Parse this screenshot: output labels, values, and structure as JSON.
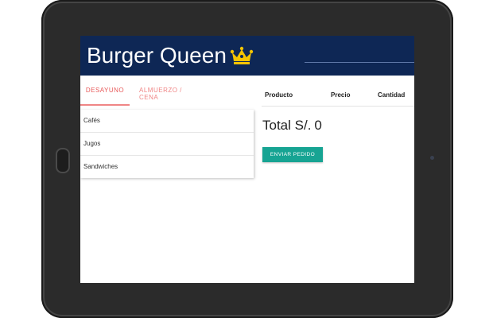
{
  "header": {
    "title": "Burger Queen",
    "icon": "crown-icon",
    "background": "#0e2755"
  },
  "tabs": [
    {
      "label": "DESAYUNO",
      "active": true
    },
    {
      "label": "ALMUERZO / CENA",
      "active": false
    }
  ],
  "menu": {
    "items": [
      {
        "label": "Cafés"
      },
      {
        "label": "Jugos"
      },
      {
        "label": "Sandwiches"
      }
    ]
  },
  "order": {
    "columns": [
      "Producto",
      "Precio",
      "Cantidad"
    ],
    "total_label": "Total S/.",
    "total_value": "0",
    "send_label": "ENVIAR PEDIDO",
    "send_color": "#17a493"
  },
  "colors": {
    "accent": "#f08585",
    "crown": "#f5c400"
  }
}
